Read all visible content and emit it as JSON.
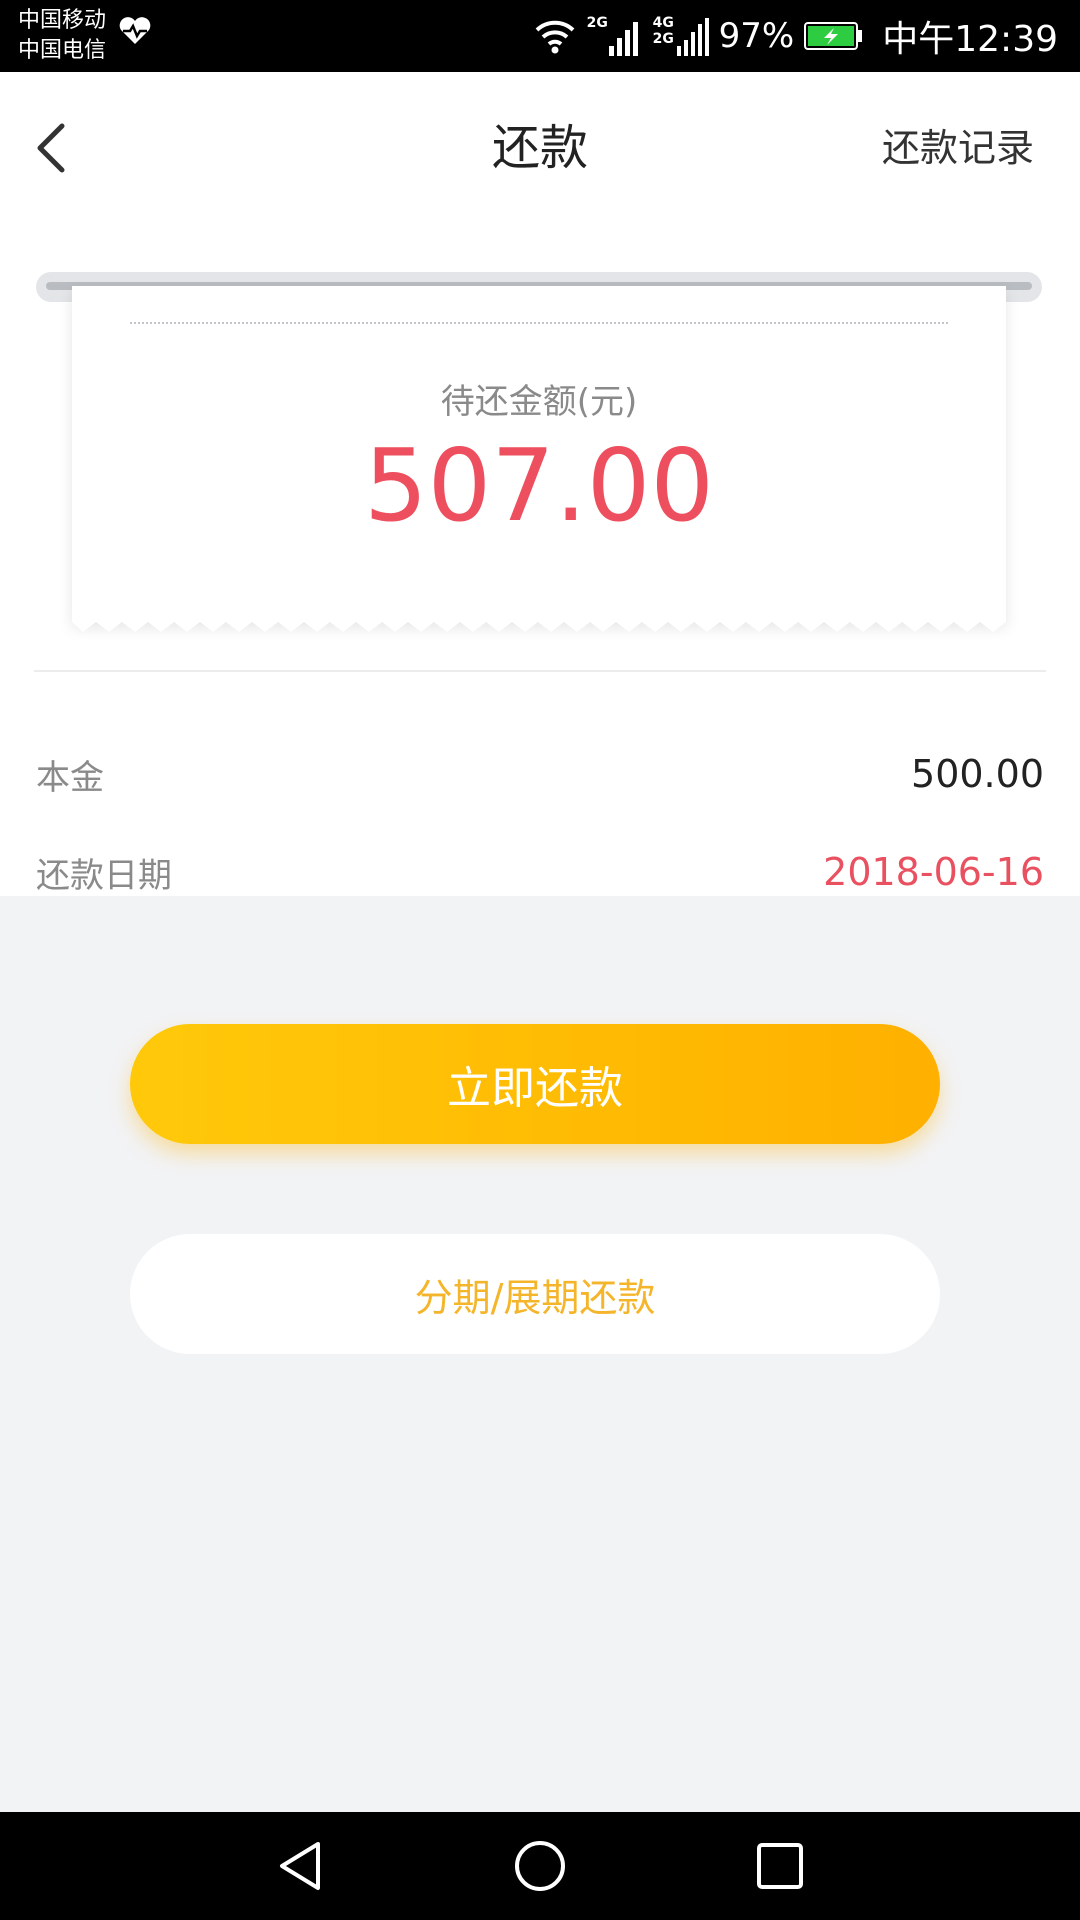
{
  "status_bar": {
    "carrier_1": "中国移动",
    "carrier_2": "中国电信",
    "network_1": "2G",
    "network_2a": "4G",
    "network_2b": "2G",
    "battery": "97%",
    "time": "中午12:39",
    "battery_color": "#2ecc40"
  },
  "header": {
    "title": "还款",
    "history_link": "还款记录",
    "back_icon": "chevron-left-icon"
  },
  "receipt": {
    "label": "待还金额(元)",
    "amount": "507.00",
    "amount_color": "#ee4f5e"
  },
  "details": [
    {
      "label": "本金",
      "value": "500.00"
    },
    {
      "label": "还款日期",
      "value": "2018-06-16",
      "value_color": "#e95060"
    }
  ],
  "actions": {
    "primary": "立即还款",
    "secondary": "分期/展期还款",
    "accent": "#ffb800"
  },
  "nav": {
    "back": "triangle-back-icon",
    "home": "circle-home-icon",
    "recents": "square-recents-icon"
  }
}
